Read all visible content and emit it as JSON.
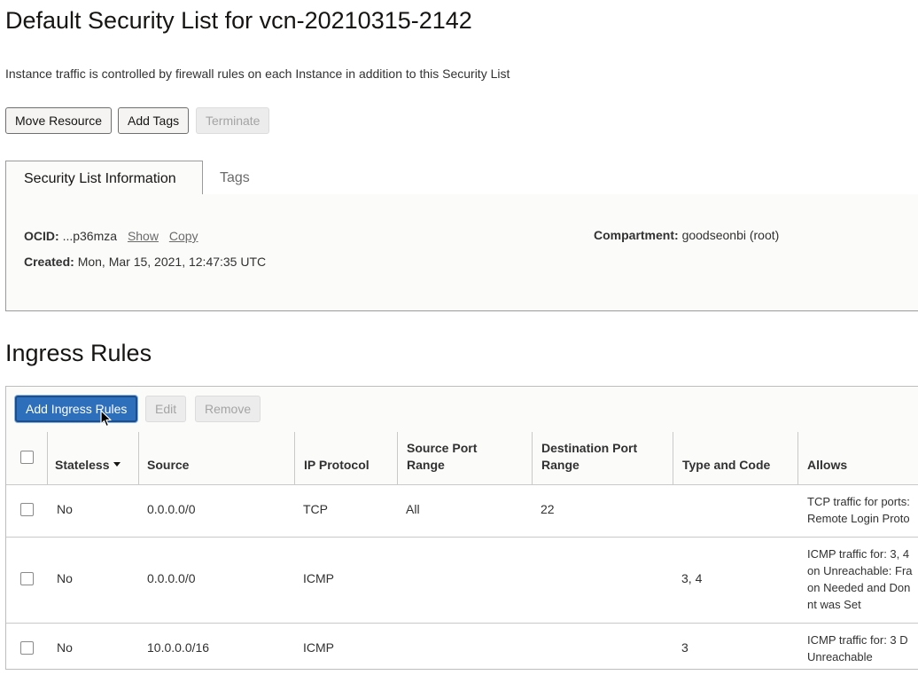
{
  "header": {
    "title": "Default Security List for vcn-20210315-2142",
    "description": "Instance traffic is controlled by firewall rules on each Instance in addition to this Security List"
  },
  "actions": {
    "move": "Move Resource",
    "tags": "Add Tags",
    "terminate": "Terminate"
  },
  "tabs": [
    {
      "label": "Security List Information",
      "active": true
    },
    {
      "label": "Tags",
      "active": false
    }
  ],
  "info": {
    "ocid_label": "OCID:",
    "ocid_value": "...p36mza",
    "show": "Show",
    "copy": "Copy",
    "created_label": "Created:",
    "created_value": "Mon, Mar 15, 2021, 12:47:35 UTC",
    "compartment_label": "Compartment:",
    "compartment_value": "goodseonbi (root)"
  },
  "ingress": {
    "title": "Ingress Rules",
    "add": "Add Ingress Rules",
    "edit": "Edit",
    "remove": "Remove",
    "columns": {
      "stateless": "Stateless",
      "source": "Source",
      "protocol": "IP Protocol",
      "src_port_1": "Source Port",
      "src_port_2": "Range",
      "dst_port_1": "Destination Port",
      "dst_port_2": "Range",
      "type_code": "Type and Code",
      "allows": "Allows"
    },
    "rows": [
      {
        "stateless": "No",
        "source": "0.0.0.0/0",
        "protocol": "TCP",
        "src_port": "All",
        "dst_port": "22",
        "type_code": "",
        "allows": [
          "TCP traffic for ports:",
          "Remote Login Proto"
        ]
      },
      {
        "stateless": "No",
        "source": "0.0.0.0/0",
        "protocol": "ICMP",
        "src_port": "",
        "dst_port": "",
        "type_code": "3, 4",
        "allows": [
          "ICMP traffic for: 3, 4",
          "on Unreachable: Fra",
          "on Needed and Don",
          "nt was Set"
        ]
      },
      {
        "stateless": "No",
        "source": "10.0.0.0/16",
        "protocol": "ICMP",
        "src_port": "",
        "dst_port": "",
        "type_code": "3",
        "allows": [
          "ICMP traffic for: 3 D",
          "Unreachable"
        ]
      }
    ]
  }
}
